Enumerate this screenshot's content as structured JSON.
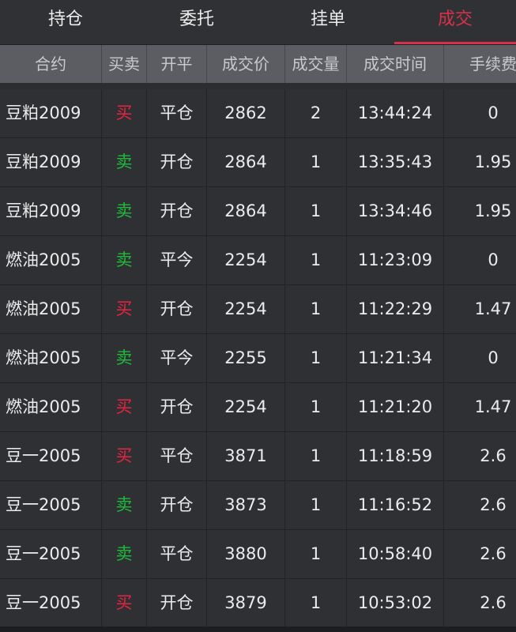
{
  "tabs": [
    {
      "label": "持仓",
      "active": false
    },
    {
      "label": "委托",
      "active": false
    },
    {
      "label": "挂单",
      "active": false
    },
    {
      "label": "成交",
      "active": true
    }
  ],
  "columns": [
    "合约",
    "买卖",
    "开平",
    "成交价",
    "成交量",
    "成交时间",
    "手续费"
  ],
  "colors": {
    "buy": "#e8233f",
    "sell": "#1fbb3a",
    "active_tab": "#d8304a"
  },
  "rows": [
    {
      "contract": "豆粕2009",
      "side": "买",
      "side_type": "buy",
      "offset": "平仓",
      "price": "2862",
      "volume": "2",
      "time": "13:44:24",
      "fee": "0"
    },
    {
      "contract": "豆粕2009",
      "side": "卖",
      "side_type": "sell",
      "offset": "开仓",
      "price": "2864",
      "volume": "1",
      "time": "13:35:43",
      "fee": "1.95"
    },
    {
      "contract": "豆粕2009",
      "side": "卖",
      "side_type": "sell",
      "offset": "开仓",
      "price": "2864",
      "volume": "1",
      "time": "13:34:46",
      "fee": "1.95"
    },
    {
      "contract": "燃油2005",
      "side": "卖",
      "side_type": "sell",
      "offset": "平今",
      "price": "2254",
      "volume": "1",
      "time": "11:23:09",
      "fee": "0"
    },
    {
      "contract": "燃油2005",
      "side": "买",
      "side_type": "buy",
      "offset": "开仓",
      "price": "2254",
      "volume": "1",
      "time": "11:22:29",
      "fee": "1.47"
    },
    {
      "contract": "燃油2005",
      "side": "卖",
      "side_type": "sell",
      "offset": "平今",
      "price": "2255",
      "volume": "1",
      "time": "11:21:34",
      "fee": "0"
    },
    {
      "contract": "燃油2005",
      "side": "买",
      "side_type": "buy",
      "offset": "开仓",
      "price": "2254",
      "volume": "1",
      "time": "11:21:20",
      "fee": "1.47"
    },
    {
      "contract": "豆一2005",
      "side": "买",
      "side_type": "buy",
      "offset": "平仓",
      "price": "3871",
      "volume": "1",
      "time": "11:18:59",
      "fee": "2.6"
    },
    {
      "contract": "豆一2005",
      "side": "卖",
      "side_type": "sell",
      "offset": "开仓",
      "price": "3873",
      "volume": "1",
      "time": "11:16:52",
      "fee": "2.6"
    },
    {
      "contract": "豆一2005",
      "side": "卖",
      "side_type": "sell",
      "offset": "平仓",
      "price": "3880",
      "volume": "1",
      "time": "10:58:40",
      "fee": "2.6"
    },
    {
      "contract": "豆一2005",
      "side": "买",
      "side_type": "buy",
      "offset": "开仓",
      "price": "3879",
      "volume": "1",
      "time": "10:53:02",
      "fee": "2.6"
    }
  ]
}
